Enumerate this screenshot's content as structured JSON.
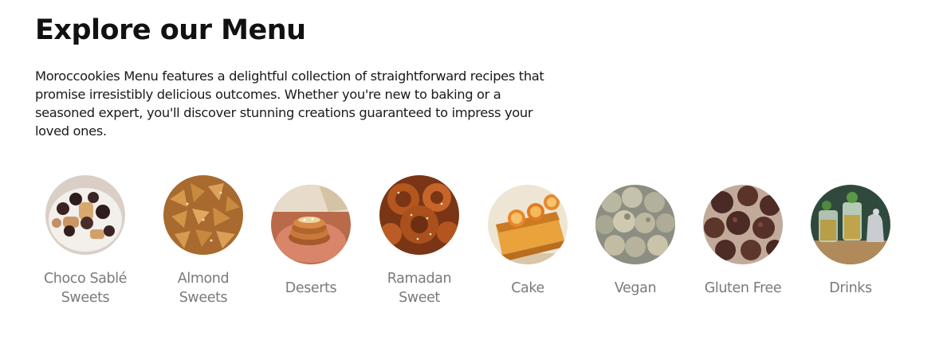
{
  "page": {
    "title": "Explore our Menu",
    "description": "Moroccookies Menu features a delightful collection of straightforward recipes that promise irresistibly delicious outcomes. Whether you're new to baking or a seasoned expert, you'll discover stunning creations guaranteed to impress your loved ones."
  },
  "menu": {
    "items": [
      {
        "line1": "Choco Sablé",
        "line2": "Sweets",
        "image": "choco-sable-sweets-photo"
      },
      {
        "line1": "Almond",
        "line2": "Sweets",
        "image": "almond-sweets-photo"
      },
      {
        "line1": "Deserts",
        "line2": "",
        "image": "deserts-photo"
      },
      {
        "line1": "Ramadan",
        "line2": "Sweet",
        "image": "ramadan-sweet-photo"
      },
      {
        "line1": "Cake",
        "line2": "",
        "image": "cake-photo"
      },
      {
        "line1": "Vegan",
        "line2": "",
        "image": "vegan-photo"
      },
      {
        "line1": "Gluten Free",
        "line2": "",
        "image": "gluten-free-photo"
      },
      {
        "line1": "Drinks",
        "line2": "",
        "image": "drinks-photo"
      }
    ]
  },
  "colors": {
    "text": "#111111",
    "label": "#7a7a7a",
    "background": "#ffffff"
  }
}
